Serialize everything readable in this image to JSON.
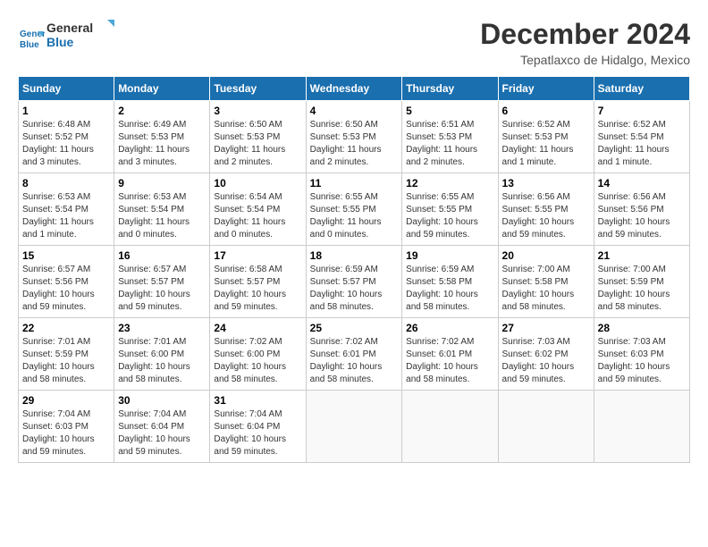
{
  "logo": {
    "line1": "General",
    "line2": "Blue"
  },
  "title": "December 2024",
  "location": "Tepatlaxco de Hidalgo, Mexico",
  "weekdays": [
    "Sunday",
    "Monday",
    "Tuesday",
    "Wednesday",
    "Thursday",
    "Friday",
    "Saturday"
  ],
  "weeks": [
    [
      {
        "day": "1",
        "sunrise": "6:48 AM",
        "sunset": "5:52 PM",
        "daylight": "11 hours and 3 minutes."
      },
      {
        "day": "2",
        "sunrise": "6:49 AM",
        "sunset": "5:53 PM",
        "daylight": "11 hours and 3 minutes."
      },
      {
        "day": "3",
        "sunrise": "6:50 AM",
        "sunset": "5:53 PM",
        "daylight": "11 hours and 2 minutes."
      },
      {
        "day": "4",
        "sunrise": "6:50 AM",
        "sunset": "5:53 PM",
        "daylight": "11 hours and 2 minutes."
      },
      {
        "day": "5",
        "sunrise": "6:51 AM",
        "sunset": "5:53 PM",
        "daylight": "11 hours and 2 minutes."
      },
      {
        "day": "6",
        "sunrise": "6:52 AM",
        "sunset": "5:53 PM",
        "daylight": "11 hours and 1 minute."
      },
      {
        "day": "7",
        "sunrise": "6:52 AM",
        "sunset": "5:54 PM",
        "daylight": "11 hours and 1 minute."
      }
    ],
    [
      {
        "day": "8",
        "sunrise": "6:53 AM",
        "sunset": "5:54 PM",
        "daylight": "11 hours and 1 minute."
      },
      {
        "day": "9",
        "sunrise": "6:53 AM",
        "sunset": "5:54 PM",
        "daylight": "11 hours and 0 minutes."
      },
      {
        "day": "10",
        "sunrise": "6:54 AM",
        "sunset": "5:54 PM",
        "daylight": "11 hours and 0 minutes."
      },
      {
        "day": "11",
        "sunrise": "6:55 AM",
        "sunset": "5:55 PM",
        "daylight": "11 hours and 0 minutes."
      },
      {
        "day": "12",
        "sunrise": "6:55 AM",
        "sunset": "5:55 PM",
        "daylight": "10 hours and 59 minutes."
      },
      {
        "day": "13",
        "sunrise": "6:56 AM",
        "sunset": "5:55 PM",
        "daylight": "10 hours and 59 minutes."
      },
      {
        "day": "14",
        "sunrise": "6:56 AM",
        "sunset": "5:56 PM",
        "daylight": "10 hours and 59 minutes."
      }
    ],
    [
      {
        "day": "15",
        "sunrise": "6:57 AM",
        "sunset": "5:56 PM",
        "daylight": "10 hours and 59 minutes."
      },
      {
        "day": "16",
        "sunrise": "6:57 AM",
        "sunset": "5:57 PM",
        "daylight": "10 hours and 59 minutes."
      },
      {
        "day": "17",
        "sunrise": "6:58 AM",
        "sunset": "5:57 PM",
        "daylight": "10 hours and 59 minutes."
      },
      {
        "day": "18",
        "sunrise": "6:59 AM",
        "sunset": "5:57 PM",
        "daylight": "10 hours and 58 minutes."
      },
      {
        "day": "19",
        "sunrise": "6:59 AM",
        "sunset": "5:58 PM",
        "daylight": "10 hours and 58 minutes."
      },
      {
        "day": "20",
        "sunrise": "7:00 AM",
        "sunset": "5:58 PM",
        "daylight": "10 hours and 58 minutes."
      },
      {
        "day": "21",
        "sunrise": "7:00 AM",
        "sunset": "5:59 PM",
        "daylight": "10 hours and 58 minutes."
      }
    ],
    [
      {
        "day": "22",
        "sunrise": "7:01 AM",
        "sunset": "5:59 PM",
        "daylight": "10 hours and 58 minutes."
      },
      {
        "day": "23",
        "sunrise": "7:01 AM",
        "sunset": "6:00 PM",
        "daylight": "10 hours and 58 minutes."
      },
      {
        "day": "24",
        "sunrise": "7:02 AM",
        "sunset": "6:00 PM",
        "daylight": "10 hours and 58 minutes."
      },
      {
        "day": "25",
        "sunrise": "7:02 AM",
        "sunset": "6:01 PM",
        "daylight": "10 hours and 58 minutes."
      },
      {
        "day": "26",
        "sunrise": "7:02 AM",
        "sunset": "6:01 PM",
        "daylight": "10 hours and 58 minutes."
      },
      {
        "day": "27",
        "sunrise": "7:03 AM",
        "sunset": "6:02 PM",
        "daylight": "10 hours and 59 minutes."
      },
      {
        "day": "28",
        "sunrise": "7:03 AM",
        "sunset": "6:03 PM",
        "daylight": "10 hours and 59 minutes."
      }
    ],
    [
      {
        "day": "29",
        "sunrise": "7:04 AM",
        "sunset": "6:03 PM",
        "daylight": "10 hours and 59 minutes."
      },
      {
        "day": "30",
        "sunrise": "7:04 AM",
        "sunset": "6:04 PM",
        "daylight": "10 hours and 59 minutes."
      },
      {
        "day": "31",
        "sunrise": "7:04 AM",
        "sunset": "6:04 PM",
        "daylight": "10 hours and 59 minutes."
      },
      null,
      null,
      null,
      null
    ]
  ]
}
